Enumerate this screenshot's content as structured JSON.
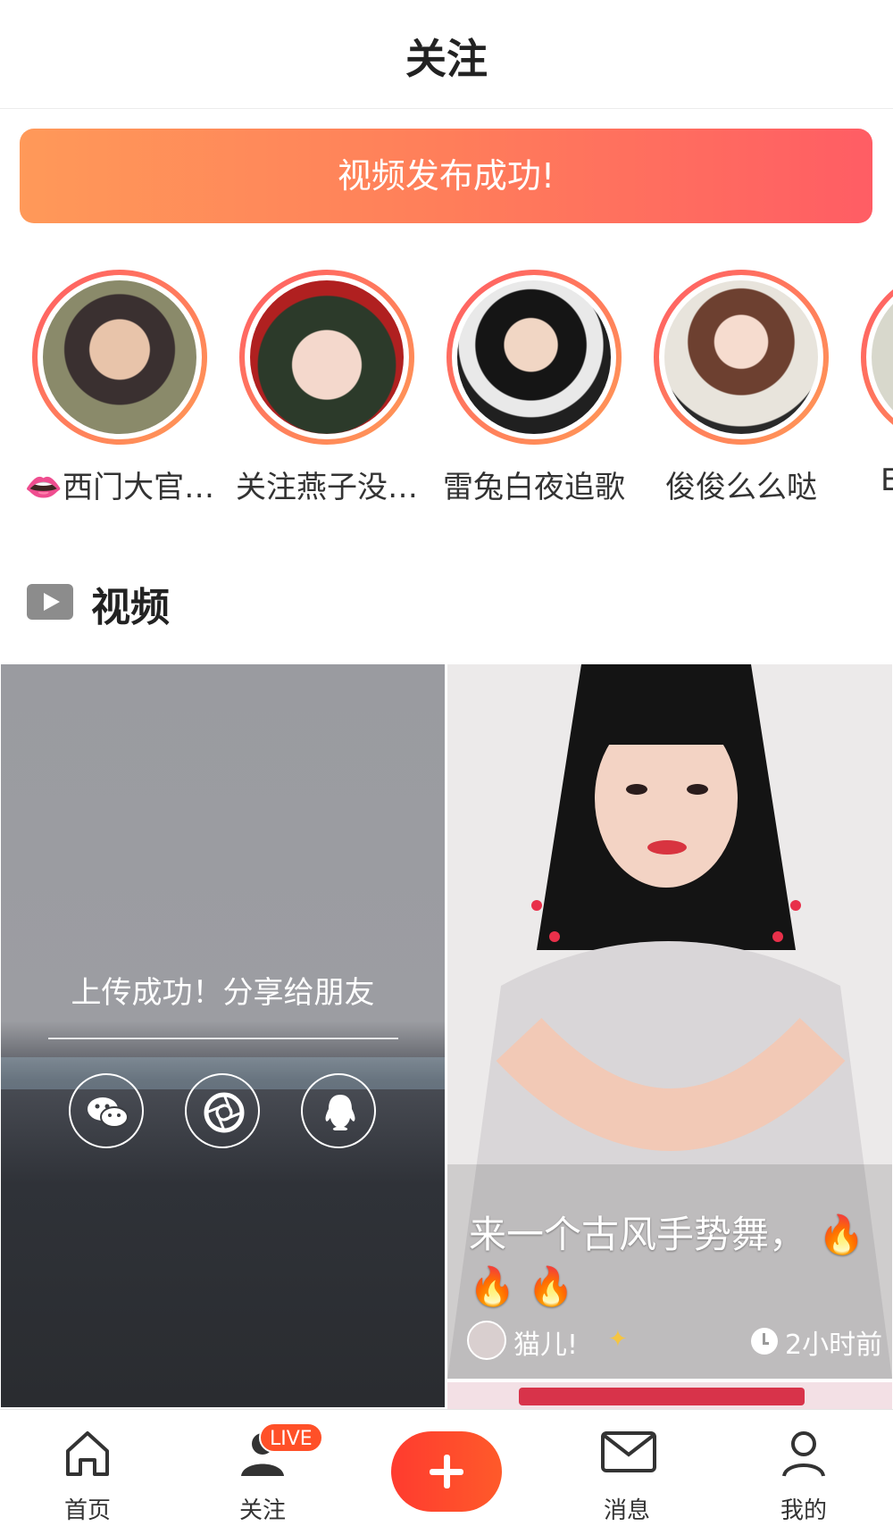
{
  "header": {
    "title": "关注"
  },
  "banner": {
    "text": "视频发布成功!"
  },
  "stories": [
    {
      "name": "👄西门大官…"
    },
    {
      "name": "关注燕子没…"
    },
    {
      "name": "雷兔白夜追歌"
    },
    {
      "name": "俊俊么么哒"
    },
    {
      "name": "E"
    }
  ],
  "section": {
    "title": "视频"
  },
  "upload_card": {
    "message": "上传成功！分享给朋友",
    "share_targets": [
      "wechat-icon",
      "moments-icon",
      "qq-icon"
    ]
  },
  "video_card": {
    "caption": "来一个古风手势舞，",
    "fire_line_1": "🔥",
    "fire_line_2": "🔥 🔥",
    "author": "猫儿!",
    "time": "2小时前"
  },
  "tabbar": {
    "home_label": "首页",
    "follow_label": "关注",
    "live_badge": "LIVE",
    "messages_label": "消息",
    "me_label": "我的"
  }
}
